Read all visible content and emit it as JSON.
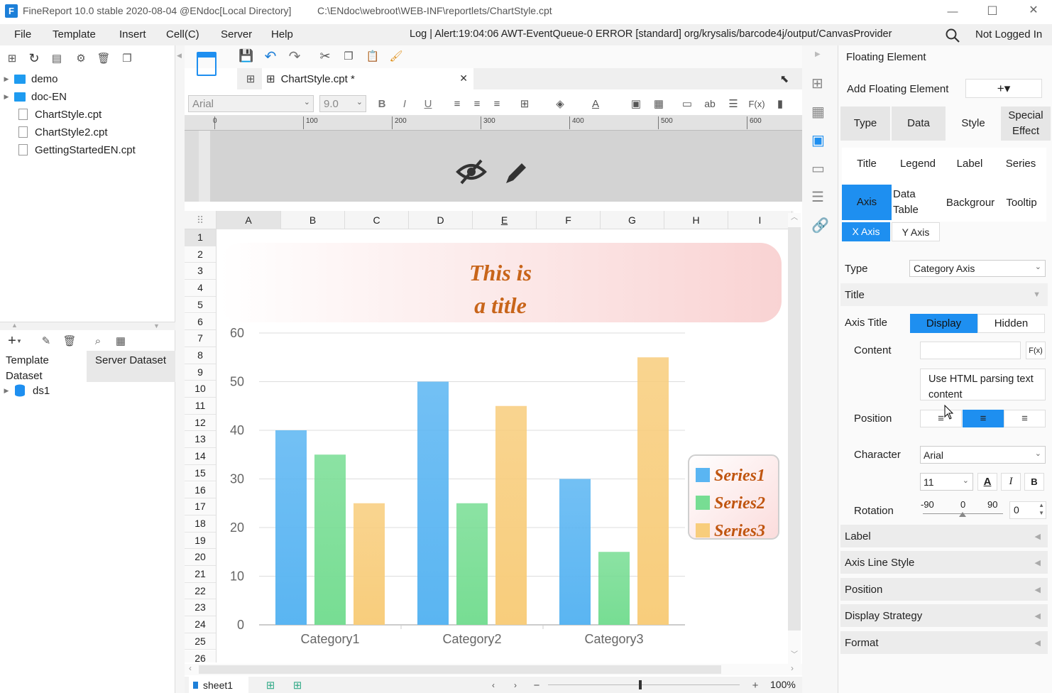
{
  "window": {
    "title": "FineReport 10.0 stable 2020-08-04 @ENdoc[Local Directory]",
    "path": "C:\\ENdoc\\webroot\\WEB-INF\\reportlets/ChartStyle.cpt",
    "minimize": "—",
    "maximize": "☐",
    "close": "✕"
  },
  "menu": {
    "items": [
      "File",
      "Template",
      "Insert",
      "Cell(C)",
      "Server",
      "Help"
    ],
    "log": "Log | Alert:19:04:06 AWT-EventQueue-0 ERROR [standard] org/krysalis/barcode4j/output/CanvasProvider",
    "login": "Not Logged In"
  },
  "tree": {
    "items": [
      {
        "label": "demo",
        "type": "folder"
      },
      {
        "label": "doc-EN",
        "type": "folder"
      },
      {
        "label": "ChartStyle.cpt",
        "type": "file"
      },
      {
        "label": "ChartStyle2.cpt",
        "type": "file"
      },
      {
        "label": "GettingStartedEN.cpt",
        "type": "file"
      }
    ]
  },
  "dataset": {
    "tab_template": "Template Dataset",
    "tab_server": "Server Dataset",
    "items": [
      "ds1"
    ]
  },
  "editor": {
    "tab_label": "ChartStyle.cpt *",
    "font": "Arial",
    "size": "9.0",
    "ruler_ticks": [
      "0",
      "100",
      "200",
      "300",
      "400",
      "500",
      "600"
    ],
    "columns": [
      "A",
      "B",
      "C",
      "D",
      "E",
      "F",
      "G",
      "H",
      "I"
    ],
    "rows": [
      "1",
      "2",
      "3",
      "4",
      "5",
      "6",
      "7",
      "8",
      "9",
      "10",
      "11",
      "12",
      "13",
      "14",
      "15",
      "16",
      "17",
      "18",
      "19",
      "20",
      "21",
      "22",
      "23",
      "24",
      "25",
      "26"
    ],
    "sheet": "sheet1",
    "zoom": "100%"
  },
  "chart_data": {
    "type": "bar",
    "title": "This is a title",
    "title_lines": [
      "This is",
      "a title"
    ],
    "categories": [
      "Category1",
      "Category2",
      "Category3"
    ],
    "series": [
      {
        "name": "Series1",
        "values": [
          40,
          50,
          30
        ],
        "color": "#5ab5f2"
      },
      {
        "name": "Series2",
        "values": [
          35,
          25,
          15
        ],
        "color": "#77dd93"
      },
      {
        "name": "Series3",
        "values": [
          25,
          45,
          55
        ],
        "color": "#f8cd7c"
      }
    ],
    "ylim": [
      0,
      60
    ],
    "yticks": [
      "0",
      "10",
      "20",
      "30",
      "40",
      "50",
      "60"
    ],
    "grid": true,
    "legend_position": "right"
  },
  "panel": {
    "header": "Floating Element",
    "add_label": "Add Floating Element",
    "add_button": "+▾",
    "tabs": [
      "Type",
      "Data",
      "Style",
      "Special Effect"
    ],
    "subtabs": [
      "Title",
      "Legend",
      "Label",
      "Series",
      "Axis",
      "Data Table",
      "Backgrour",
      "Tooltip"
    ],
    "axis_tabs": [
      "X Axis",
      "Y Axis"
    ],
    "type_label": "Type",
    "type_value": "Category Axis",
    "title_section": "Title",
    "axis_title_label": "Axis Title",
    "display": "Display",
    "hidden": "Hidden",
    "content_label": "Content",
    "content_value": "",
    "fx": "F(x)",
    "html_note": "Use HTML parsing text content",
    "position_label": "Position",
    "character_label": "Character",
    "char_font": "Arial",
    "char_size": "11",
    "rotation_label": "Rotation",
    "rotation_min": "-90",
    "rotation_mid": "0",
    "rotation_max": "90",
    "rotation_value": "0",
    "sections": [
      "Label",
      "Axis Line Style",
      "Position",
      "Display Strategy",
      "Format"
    ]
  },
  "colors": {
    "accent": "#1e8ff0",
    "title_color": "#c8651a",
    "legend_text": "#c0550f"
  }
}
